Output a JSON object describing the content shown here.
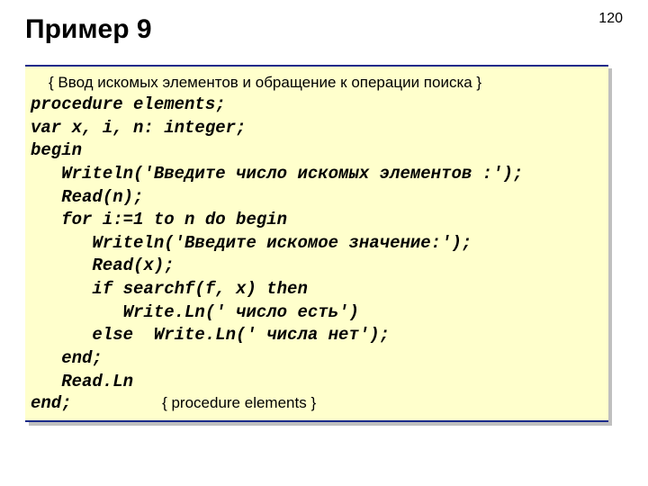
{
  "page_number": "120",
  "title": "Пример 9",
  "code": {
    "comment_top": "{ Ввод искомых элементов и обращение к операции поиска }",
    "body": "procedure elements;\nvar x, i, n: integer;\nbegin\n   Writeln('Введите число искомых элементов :');\n   Read(n);\n   for i:=1 to n do begin\n      Writeln('Введите искомое значение:');\n      Read(x);\n      if searchf(f, x) then\n         Write.Ln(' число есть')\n      else  Write.Ln(' числа нет');\n   end;\n   Read.Ln",
    "last_keyword": "end;",
    "last_comment": "{ procedure elements }"
  }
}
